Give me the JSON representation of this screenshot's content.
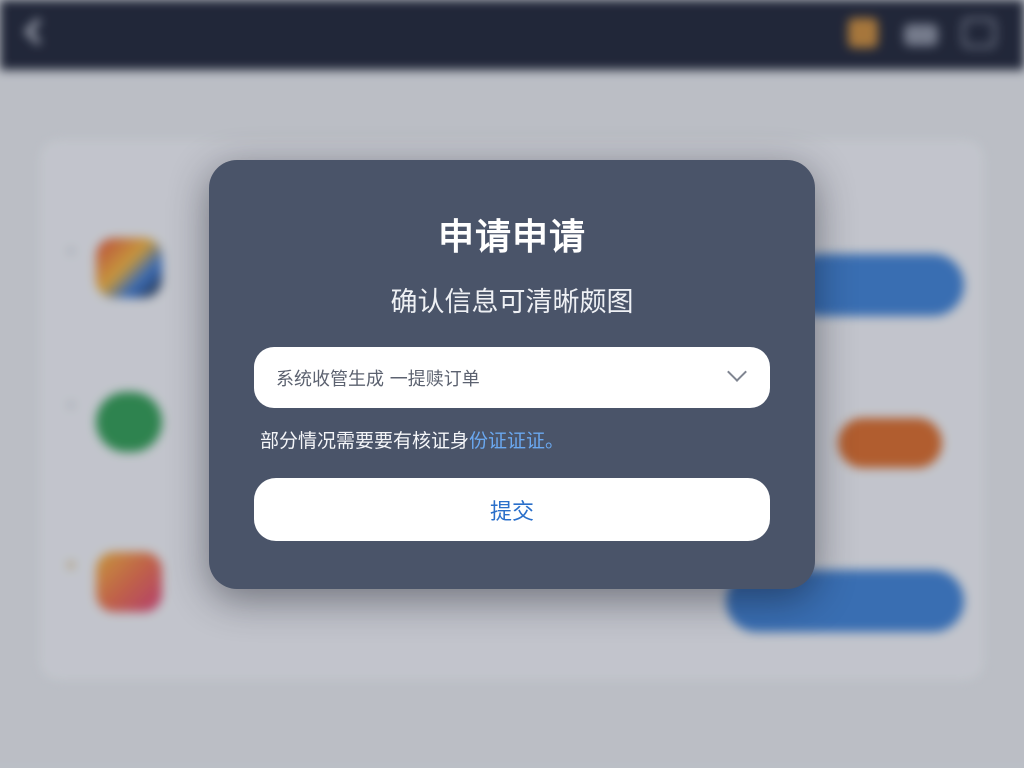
{
  "background": {
    "top_bar": {
      "title": "",
      "tag1": "",
      "tag2": ""
    },
    "breadcrumb": "",
    "section_title": "",
    "apps": [
      {
        "name": "",
        "button": "",
        "color": "#3d7fd1",
        "info": ""
      },
      {
        "name": "",
        "button": "",
        "color": "#d66a2a",
        "info": ""
      },
      {
        "name": "",
        "button": "",
        "color": "#3d7fd1",
        "info": ""
      }
    ]
  },
  "dialog": {
    "title": "申请申请",
    "subtitle": "确认信息可清晰颇图",
    "select": {
      "value": "系统收管生成  一提赎订单"
    },
    "notice_prefix": "部分情况需要要有核证身",
    "notice_link": "份证证证。",
    "submit_label": "提交"
  },
  "colors": {
    "dialog_bg": "#4a5469",
    "accent_blue": "#2a6fca",
    "link_blue": "#6aa8f0",
    "top_bar_bg": "#1e2436"
  }
}
